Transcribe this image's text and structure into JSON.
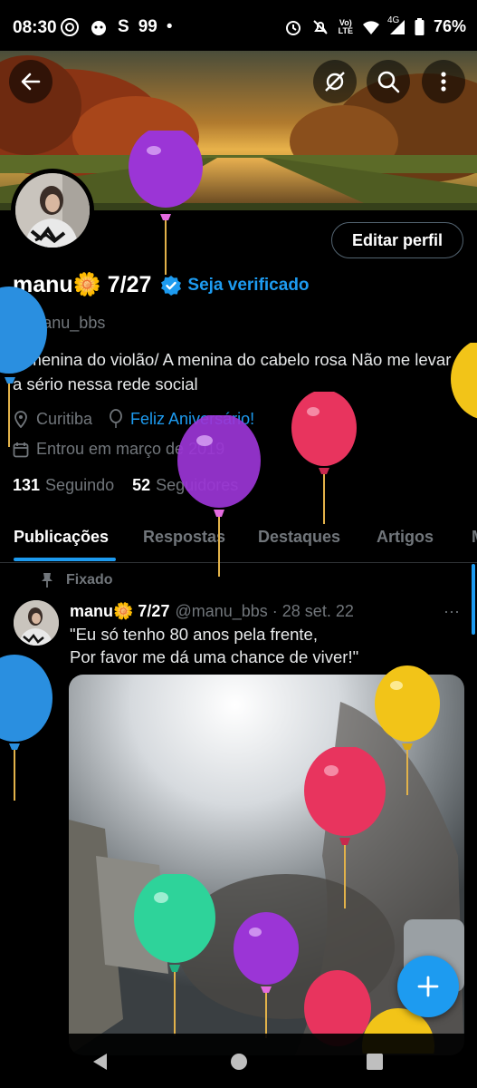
{
  "status_bar": {
    "time": "08:30",
    "carrier_badge": "99",
    "s_app": "S",
    "volte_top": "Vo)",
    "volte_bottom": "LTE",
    "network": "4G",
    "battery": "76%"
  },
  "profile": {
    "name": "manu🌼 7/27",
    "verify_label": "Seja verificado",
    "handle": "@manu_bbs",
    "bio": "A menina do violão/ A menina do cabelo rosa Não me levar a sério nessa rede social",
    "location": "Curitiba",
    "birthday_link": "Feliz Aniversário!",
    "joined": "Entrou em março de 2019",
    "following_count": "131",
    "following_label": "Seguindo",
    "followers_count": "52",
    "followers_label": "Seguidores",
    "edit_label": "Editar perfil"
  },
  "tabs": [
    "Publicações",
    "Respostas",
    "Destaques",
    "Artigos",
    "M"
  ],
  "post": {
    "pinned_label": "Fixado",
    "author": "manu🌼 7/27",
    "meta": "@manu_bbs · 28 set. 22",
    "more": "···",
    "text_line1": "\"Eu só tenho 80 anos pela frente,",
    "text_line2": "Por favor me dá uma chance de viver!\""
  },
  "colors": {
    "accent": "#1d9bf0",
    "background": "#000000",
    "muted": "#71767b",
    "balloon_purple": "#9b35d6",
    "balloon_red": "#e8345e",
    "balloon_blue": "#2a8fe0",
    "balloon_yellow": "#f2c418",
    "balloon_green": "#2ed39a"
  },
  "icons": [
    "back-arrow-icon",
    "cross-device-icon",
    "search-icon",
    "more-vertical-icon",
    "verified-badge-icon",
    "location-icon",
    "balloon-icon",
    "calendar-icon",
    "pin-icon",
    "plus-icon",
    "nav-back-icon",
    "nav-home-icon",
    "nav-recents-icon"
  ]
}
